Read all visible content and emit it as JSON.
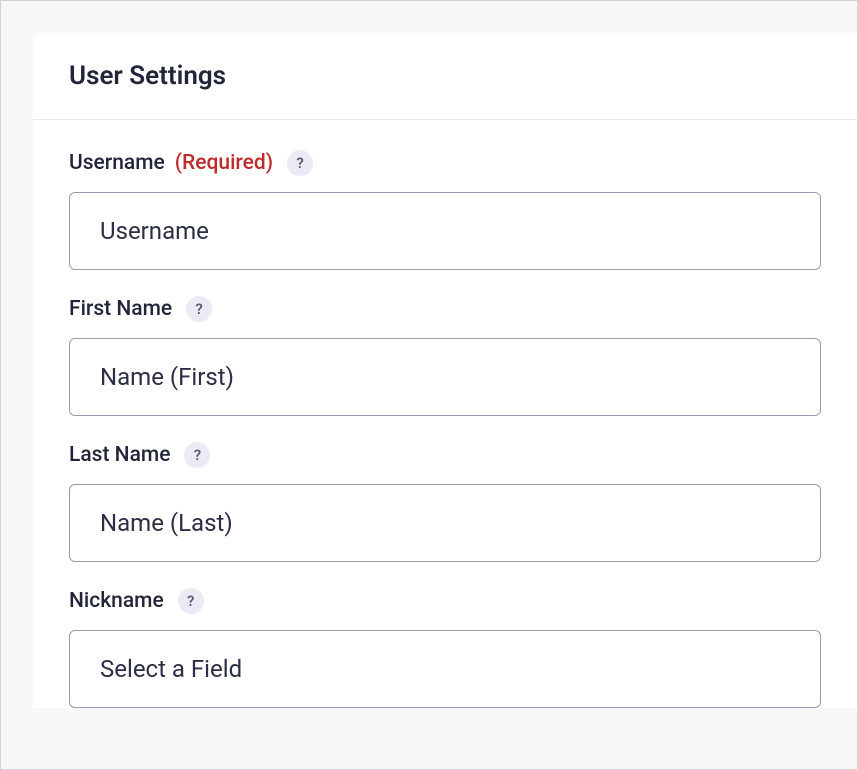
{
  "panel": {
    "title": "User Settings"
  },
  "fields": {
    "username": {
      "label": "Username",
      "required_text": "(Required)",
      "help": "?",
      "value": "Username"
    },
    "first_name": {
      "label": "First Name",
      "help": "?",
      "value": "Name (First)"
    },
    "last_name": {
      "label": "Last Name",
      "help": "?",
      "value": "Name (Last)"
    },
    "nickname": {
      "label": "Nickname",
      "help": "?",
      "placeholder": "Select a Field"
    }
  }
}
